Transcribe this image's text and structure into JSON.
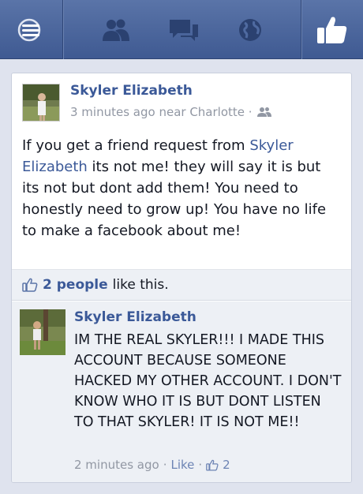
{
  "topbar": {
    "icons": [
      "menu-icon",
      "friend-requests-icon",
      "messages-icon",
      "notifications-globe-icon",
      "like-icon"
    ]
  },
  "post": {
    "author": "Skyler Elizabeth",
    "meta": "3 minutes ago near Charlotte ·",
    "text_before": "If you get a friend request from ",
    "text_link": "Skyler Elizabeth",
    "text_after": " its not me! they will say it is but its not but dont add them! You need to honestly need to grow up! You have no life to make a facebook about me!"
  },
  "likes": {
    "count": "2 people",
    "suffix": "like this."
  },
  "comment": {
    "author": "Skyler Elizabeth",
    "text": "IM THE REAL SKYLER!!! I MADE THIS ACCOUNT BECAUSE SOMEONE HACKED MY OTHER ACCOUNT. I DON'T KNOW WHO IT IS BUT DONT LISTEN TO THAT SKYLER! IT IS NOT ME!!",
    "time": "2 minutes ago",
    "sep1": "·",
    "like_label": "Like",
    "sep2": "·",
    "like_count": "2"
  }
}
